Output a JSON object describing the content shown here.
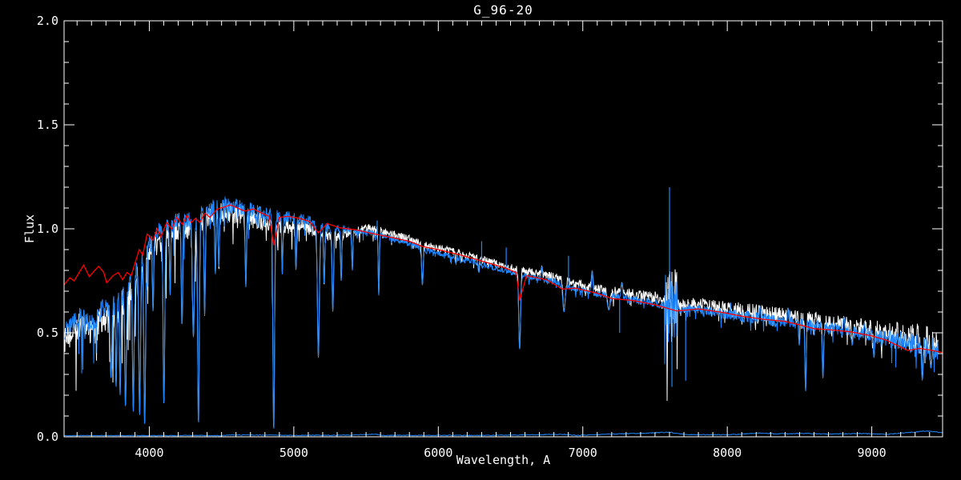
{
  "window": {
    "background": "#000000"
  },
  "chart_data": {
    "type": "line",
    "title": "G_96-20",
    "xlabel": "Wavelength, A",
    "ylabel": "Flux",
    "xlim": [
      3410,
      9490
    ],
    "ylim": [
      0.0,
      2.0
    ],
    "grid": false,
    "axis_color": "#ffffff",
    "background": "#000000",
    "x_major_ticks": [
      4000,
      5000,
      6000,
      7000,
      8000,
      9000
    ],
    "x_tick_labels": [
      "4000",
      "5000",
      "6000",
      "7000",
      "8000",
      "9000"
    ],
    "x_minor_step": 100,
    "y_major_ticks": [
      0.0,
      0.5,
      1.0,
      1.5,
      2.0
    ],
    "y_tick_labels": [
      "0.0",
      "0.5",
      "1.0",
      "1.5",
      "2.0"
    ],
    "y_minor_step": 0.1,
    "seed": 1234,
    "continuum": [
      [
        3410,
        0.5
      ],
      [
        3470,
        0.55
      ],
      [
        3520,
        0.58
      ],
      [
        3570,
        0.55
      ],
      [
        3620,
        0.55
      ],
      [
        3680,
        0.62
      ],
      [
        3740,
        0.62
      ],
      [
        3800,
        0.68
      ],
      [
        3860,
        0.72
      ],
      [
        3920,
        0.82
      ],
      [
        3980,
        0.9
      ],
      [
        4040,
        0.97
      ],
      [
        4100,
        1.0
      ],
      [
        4160,
        1.03
      ],
      [
        4220,
        1.04
      ],
      [
        4280,
        1.04
      ],
      [
        4340,
        1.06
      ],
      [
        4400,
        1.09
      ],
      [
        4460,
        1.11
      ],
      [
        4520,
        1.12
      ],
      [
        4600,
        1.11
      ],
      [
        4700,
        1.09
      ],
      [
        4800,
        1.07
      ],
      [
        4900,
        1.06
      ],
      [
        5000,
        1.05
      ],
      [
        5100,
        1.04
      ],
      [
        5200,
        1.01
      ],
      [
        5300,
        1.0
      ],
      [
        5400,
        0.99
      ],
      [
        5500,
        0.985
      ],
      [
        5600,
        0.97
      ],
      [
        5700,
        0.95
      ],
      [
        5800,
        0.93
      ],
      [
        5900,
        0.9
      ],
      [
        6000,
        0.885
      ],
      [
        6100,
        0.87
      ],
      [
        6200,
        0.85
      ],
      [
        6300,
        0.83
      ],
      [
        6400,
        0.81
      ],
      [
        6500,
        0.79
      ],
      [
        6600,
        0.775
      ],
      [
        6700,
        0.76
      ],
      [
        6800,
        0.745
      ],
      [
        6900,
        0.72
      ],
      [
        7000,
        0.705
      ],
      [
        7100,
        0.69
      ],
      [
        7200,
        0.675
      ],
      [
        7300,
        0.665
      ],
      [
        7400,
        0.655
      ],
      [
        7500,
        0.645
      ],
      [
        7560,
        0.63
      ],
      [
        7600,
        0.6
      ],
      [
        7660,
        0.615
      ],
      [
        7800,
        0.615
      ],
      [
        7900,
        0.6
      ],
      [
        8000,
        0.59
      ],
      [
        8100,
        0.58
      ],
      [
        8200,
        0.57
      ],
      [
        8300,
        0.56
      ],
      [
        8400,
        0.555
      ],
      [
        8500,
        0.545
      ],
      [
        8600,
        0.535
      ],
      [
        8700,
        0.52
      ],
      [
        8800,
        0.51
      ],
      [
        8900,
        0.5
      ],
      [
        9000,
        0.49
      ],
      [
        9100,
        0.47
      ],
      [
        9200,
        0.46
      ],
      [
        9300,
        0.45
      ],
      [
        9400,
        0.43
      ],
      [
        9460,
        0.42
      ]
    ],
    "noise_profile": [
      [
        3410,
        0.045
      ],
      [
        3700,
        0.05
      ],
      [
        4400,
        0.04
      ],
      [
        5000,
        0.03
      ],
      [
        5400,
        0.015
      ],
      [
        6500,
        0.013
      ],
      [
        7000,
        0.015
      ],
      [
        7500,
        0.02
      ],
      [
        7800,
        0.022
      ],
      [
        8150,
        0.03
      ],
      [
        8500,
        0.028
      ],
      [
        9000,
        0.035
      ],
      [
        9250,
        0.05
      ],
      [
        9460,
        0.055
      ]
    ],
    "noise_bumps": [
      [
        7565,
        7655,
        0.14
      ]
    ],
    "absorption_lines": [
      [
        3735,
        0.28,
        12
      ],
      [
        3770,
        0.24,
        10
      ],
      [
        3798,
        0.2,
        10
      ],
      [
        3835,
        0.14,
        12
      ],
      [
        3889,
        0.12,
        12
      ],
      [
        3933,
        0.1,
        13
      ],
      [
        3968,
        0.05,
        13
      ],
      [
        4026,
        0.6,
        9
      ],
      [
        4101,
        0.15,
        13
      ],
      [
        4144,
        0.68,
        9
      ],
      [
        4226,
        0.52,
        10
      ],
      [
        4305,
        0.48,
        16
      ],
      [
        4340,
        0.05,
        13
      ],
      [
        4383,
        0.58,
        10
      ],
      [
        4457,
        0.78,
        9
      ],
      [
        4481,
        0.8,
        9
      ],
      [
        4668,
        0.72,
        10
      ],
      [
        4861,
        0.02,
        13
      ],
      [
        4920,
        0.78,
        9
      ],
      [
        5015,
        0.8,
        9
      ],
      [
        5170,
        0.38,
        15
      ],
      [
        5210,
        0.72,
        9
      ],
      [
        5270,
        0.6,
        12
      ],
      [
        5328,
        0.75,
        9
      ],
      [
        5405,
        0.8,
        9
      ],
      [
        5588,
        0.68,
        9
      ],
      [
        5890,
        0.73,
        13
      ],
      [
        6122,
        0.83,
        8
      ],
      [
        6162,
        0.84,
        8
      ],
      [
        6280,
        0.79,
        10
      ],
      [
        6495,
        0.8,
        8
      ],
      [
        6563,
        0.42,
        15
      ],
      [
        6717,
        0.82,
        8
      ],
      [
        6870,
        0.6,
        18
      ],
      [
        7065,
        0.8,
        10
      ],
      [
        7180,
        0.61,
        22
      ],
      [
        7270,
        0.74,
        14
      ],
      [
        8227,
        0.63,
        10
      ],
      [
        8420,
        0.62,
        9
      ],
      [
        8498,
        0.44,
        10
      ],
      [
        8542,
        0.22,
        11
      ],
      [
        8662,
        0.28,
        11
      ],
      [
        8750,
        0.54,
        10
      ],
      [
        8807,
        0.58,
        10
      ],
      [
        8865,
        0.44,
        11
      ],
      [
        8950,
        0.55,
        10
      ],
      [
        9015,
        0.38,
        11
      ],
      [
        9110,
        0.48,
        11
      ],
      [
        9245,
        0.44,
        11
      ],
      [
        9350,
        0.27,
        12
      ],
      [
        9410,
        0.33,
        11
      ]
    ],
    "emission_spikes": [
      [
        5577,
        1.04
      ],
      [
        6300,
        0.94
      ],
      [
        6470,
        0.91
      ],
      [
        6901,
        0.87
      ],
      [
        7600,
        1.2
      ],
      [
        8025,
        0.645
      ],
      [
        8430,
        0.61
      ],
      [
        9310,
        0.49
      ]
    ],
    "down_spikes": [
      [
        7255,
        0.5
      ],
      [
        7617,
        0.24
      ],
      [
        7712,
        0.27
      ]
    ],
    "series": [
      {
        "name": "observed-spectrum-secondary",
        "role": "second observed spectrum (white, behind)",
        "color": "#ffffff",
        "noise_scale": 1.35,
        "range": [
          3410,
          9460
        ],
        "offset_profile": [
          [
            3410,
            -0.045
          ],
          [
            5300,
            -0.035
          ],
          [
            5500,
            0.02
          ],
          [
            7000,
            0.025
          ],
          [
            9460,
            0.03
          ]
        ]
      },
      {
        "name": "observed-spectrum-primary",
        "role": "observed spectrum (blue)",
        "color": "#1e87ff",
        "noise_scale": 1.0,
        "range": [
          3410,
          9460
        ],
        "offset_profile": [
          [
            3410,
            0
          ],
          [
            9460,
            0
          ]
        ]
      },
      {
        "name": "template-spectrum",
        "role": "smooth comparison template (red)",
        "color": "#ff0000",
        "points": [
          [
            3410,
            0.73
          ],
          [
            3450,
            0.765
          ],
          [
            3480,
            0.75
          ],
          [
            3545,
            0.825
          ],
          [
            3585,
            0.77
          ],
          [
            3615,
            0.795
          ],
          [
            3650,
            0.82
          ],
          [
            3685,
            0.79
          ],
          [
            3705,
            0.74
          ],
          [
            3750,
            0.775
          ],
          [
            3785,
            0.79
          ],
          [
            3815,
            0.755
          ],
          [
            3845,
            0.79
          ],
          [
            3875,
            0.775
          ],
          [
            3930,
            0.9
          ],
          [
            3955,
            0.875
          ],
          [
            3985,
            0.975
          ],
          [
            4025,
            0.945
          ],
          [
            4055,
            1.0
          ],
          [
            4080,
            0.96
          ],
          [
            4120,
            1.03
          ],
          [
            4155,
            1.0
          ],
          [
            4190,
            1.055
          ],
          [
            4230,
            1.02
          ],
          [
            4260,
            1.065
          ],
          [
            4290,
            1.03
          ],
          [
            4320,
            1.05
          ],
          [
            4350,
            1.03
          ],
          [
            4385,
            1.075
          ],
          [
            4420,
            1.055
          ],
          [
            4470,
            1.095
          ],
          [
            4520,
            1.105
          ],
          [
            4560,
            1.115
          ],
          [
            4610,
            1.1
          ],
          [
            4660,
            1.085
          ],
          [
            4720,
            1.095
          ],
          [
            4780,
            1.075
          ],
          [
            4830,
            1.06
          ],
          [
            4861,
            0.92
          ],
          [
            4900,
            1.055
          ],
          [
            4960,
            1.06
          ],
          [
            5040,
            1.05
          ],
          [
            5110,
            1.035
          ],
          [
            5170,
            0.98
          ],
          [
            5230,
            1.025
          ],
          [
            5320,
            1.005
          ],
          [
            5430,
            0.995
          ],
          [
            5560,
            0.975
          ],
          [
            5700,
            0.955
          ],
          [
            5800,
            0.94
          ],
          [
            5890,
            0.915
          ],
          [
            6000,
            0.9
          ],
          [
            6150,
            0.875
          ],
          [
            6300,
            0.845
          ],
          [
            6450,
            0.815
          ],
          [
            6540,
            0.79
          ],
          [
            6563,
            0.655
          ],
          [
            6610,
            0.775
          ],
          [
            6750,
            0.755
          ],
          [
            6860,
            0.71
          ],
          [
            6950,
            0.715
          ],
          [
            7100,
            0.69
          ],
          [
            7200,
            0.665
          ],
          [
            7350,
            0.655
          ],
          [
            7500,
            0.635
          ],
          [
            7650,
            0.605
          ],
          [
            7800,
            0.615
          ],
          [
            7950,
            0.6
          ],
          [
            8100,
            0.58
          ],
          [
            8250,
            0.565
          ],
          [
            8400,
            0.555
          ],
          [
            8520,
            0.535
          ],
          [
            8600,
            0.52
          ],
          [
            8700,
            0.515
          ],
          [
            8850,
            0.505
          ],
          [
            9000,
            0.485
          ],
          [
            9100,
            0.465
          ],
          [
            9160,
            0.445
          ],
          [
            9250,
            0.415
          ],
          [
            9330,
            0.425
          ],
          [
            9420,
            0.415
          ],
          [
            9490,
            0.405
          ]
        ]
      },
      {
        "name": "noise-floor",
        "role": "error / sky level near zero flux (blue)",
        "color": "#1e87ff",
        "points": [
          [
            3410,
            0.006
          ],
          [
            4500,
            0.006
          ],
          [
            4560,
            0.009
          ],
          [
            5000,
            0.007
          ],
          [
            5400,
            0.008
          ],
          [
            5560,
            0.013
          ],
          [
            5620,
            0.007
          ],
          [
            6300,
            0.007
          ],
          [
            6870,
            0.012
          ],
          [
            6950,
            0.007
          ],
          [
            7600,
            0.022
          ],
          [
            7720,
            0.01
          ],
          [
            8000,
            0.01
          ],
          [
            8230,
            0.018
          ],
          [
            8350,
            0.014
          ],
          [
            8550,
            0.016
          ],
          [
            8700,
            0.013
          ],
          [
            8920,
            0.016
          ],
          [
            9100,
            0.012
          ],
          [
            9250,
            0.02
          ],
          [
            9380,
            0.028
          ],
          [
            9460,
            0.022
          ]
        ]
      }
    ]
  }
}
